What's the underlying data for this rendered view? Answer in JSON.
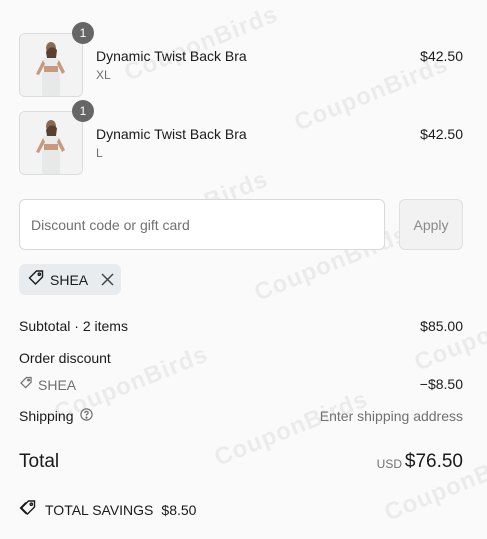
{
  "watermark": "CouponBirds",
  "line_items": [
    {
      "title": "Dynamic Twist Back Bra",
      "variant": "XL",
      "price": "$42.50",
      "quantity": "1"
    },
    {
      "title": "Dynamic Twist Back Bra",
      "variant": "L",
      "price": "$42.50",
      "quantity": "1"
    }
  ],
  "discount": {
    "placeholder": "Discount code or gift card",
    "apply_label": "Apply",
    "applied_code": "SHEA"
  },
  "summary": {
    "subtotal_label": "Subtotal · 2 items",
    "subtotal_value": "$85.00",
    "order_discount_label": "Order discount",
    "discount_code": "SHEA",
    "discount_value": "−$8.50",
    "shipping_label": "Shipping",
    "shipping_value": "Enter shipping address",
    "total_label": "Total",
    "currency": "USD",
    "total_value": "$76.50",
    "savings_label": "TOTAL SAVINGS",
    "savings_value": "$8.50"
  }
}
